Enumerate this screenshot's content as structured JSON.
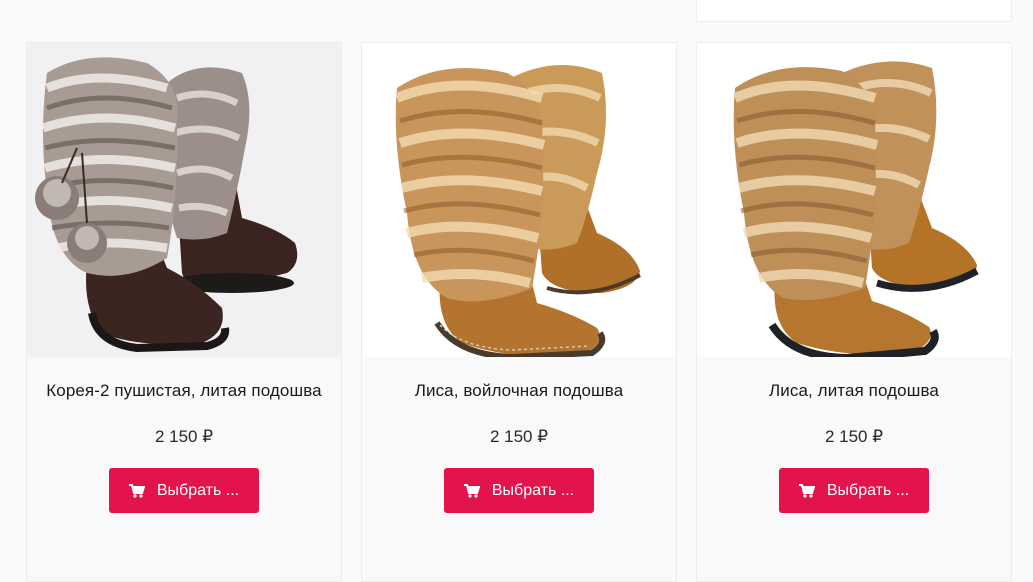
{
  "products": [
    {
      "title": "Корея-2 пушистая, литая подошва",
      "price": "2 150 ₽",
      "button_label": "Выбрать ...",
      "image": "grey-fur-brown-boots-photo"
    },
    {
      "title": "Лиса, войлочная подошва",
      "price": "2 150 ₽",
      "button_label": "Выбрать ...",
      "image": "fox-fur-tan-felt-boots-photo"
    },
    {
      "title": "Лиса, литая подошва",
      "price": "2 150 ₽",
      "button_label": "Выбрать ...",
      "image": "fox-fur-tan-cast-sole-boots-photo"
    }
  ],
  "colors": {
    "button": "#e3134b",
    "card_bg": "#f9f9f9"
  },
  "icons": {
    "button_icon": "cart-icon"
  }
}
